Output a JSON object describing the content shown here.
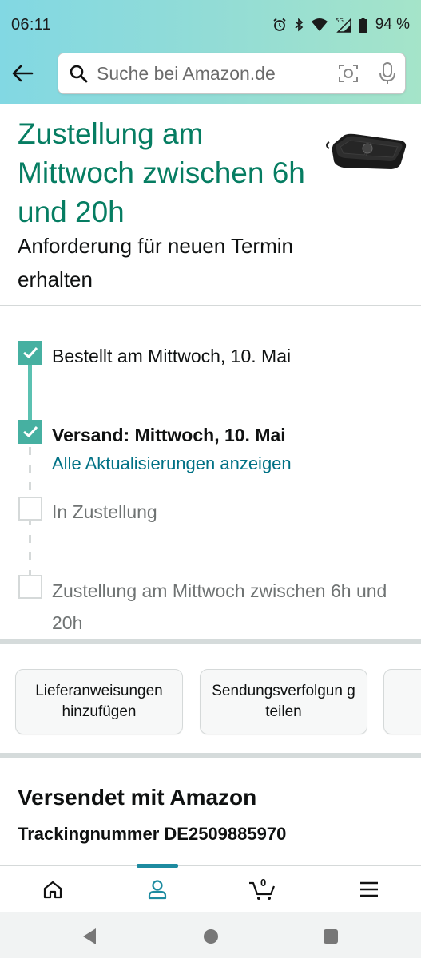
{
  "status_bar": {
    "time": "06:11",
    "battery": "94 %",
    "network": "5G"
  },
  "search": {
    "placeholder": "Suche bei Amazon.de"
  },
  "delivery": {
    "title": "Zustellung am Mittwoch zwischen 6h und 20h",
    "subtitle": "Anforderung für neuen Termin erhalten"
  },
  "timeline": {
    "steps": [
      {
        "label": "Bestellt am Mittwoch, 10. Mai",
        "status": "done"
      },
      {
        "label": "Versand: Mittwoch, 10. Mai",
        "status": "done"
      },
      {
        "label": "In Zustellung",
        "status": "pending"
      },
      {
        "label": "Zustellung am Mittwoch zwischen 6h und 20h",
        "status": "pending"
      }
    ],
    "updates_link": "Alle Aktualisierungen anzeigen"
  },
  "actions": {
    "buttons": [
      {
        "label": "Lieferanweisungen hinzufügen"
      },
      {
        "label": "Sendungsverfolgun g teilen"
      }
    ]
  },
  "shipping": {
    "title": "Versendet mit Amazon",
    "tracking": "Trackingnummer DE2509885970"
  },
  "bottom_nav": {
    "items": [
      "home-icon",
      "account-icon",
      "cart-icon",
      "menu-icon"
    ],
    "cart_count": "0",
    "active": "account-icon"
  },
  "colors": {
    "accent": "#067d62",
    "check_fill": "#46b0a1",
    "link": "#007185",
    "nav_indicator": "#1d8ba0"
  }
}
